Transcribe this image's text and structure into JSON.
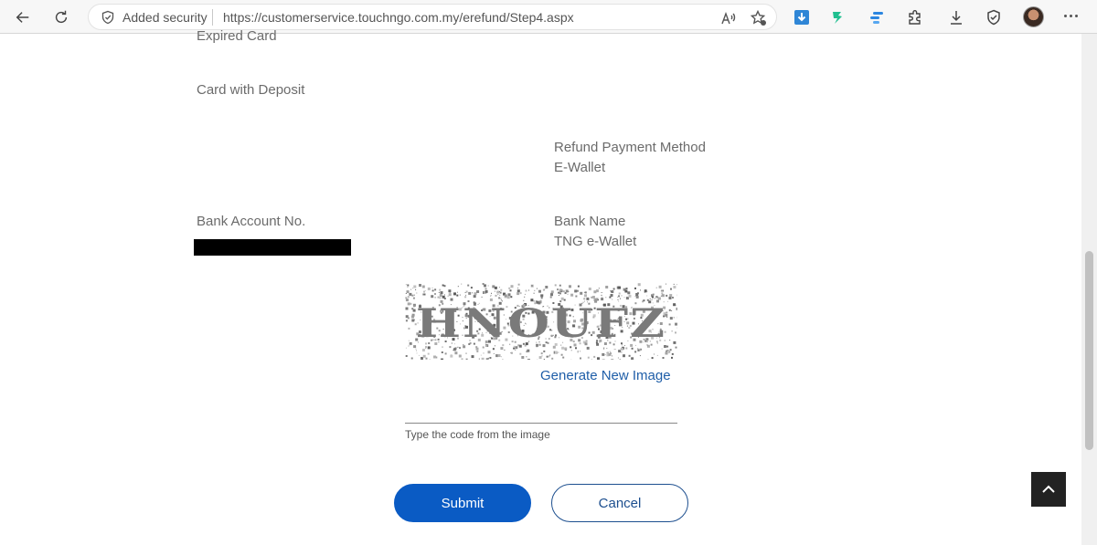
{
  "browser": {
    "security_label": "Added security",
    "url": "https://customerservice.touchngo.com.my/erefund/Step4.aspx",
    "icons": [
      "back-arrow-icon",
      "refresh-icon",
      "shield-icon",
      "read-aloud-icon",
      "favorites-star-icon",
      "download-extension-icon",
      "pin-extension-icon",
      "task-extension-icon",
      "extensions-puzzle-icon",
      "downloads-icon",
      "browser-essentials-icon",
      "profile-avatar",
      "more-menu-icon"
    ]
  },
  "form": {
    "expired_card": "Expired Card",
    "card_with_deposit": "Card with Deposit",
    "refund_method_label": "Refund Payment Method",
    "refund_method_value": "E-Wallet",
    "bank_account_label": "Bank Account No.",
    "bank_name_label": "Bank Name",
    "bank_name_value": "TNG e-Wallet"
  },
  "captcha": {
    "text": "HNOUFZ",
    "generate_link": "Generate New Image",
    "input_value": "",
    "hint": "Type the code from the image"
  },
  "buttons": {
    "submit": "Submit",
    "cancel": "Cancel"
  },
  "colors": {
    "primary": "#0a5bc4",
    "link": "#1f5ea8",
    "label_text": "#6b6b6b",
    "back_to_top_bg": "#222222"
  }
}
